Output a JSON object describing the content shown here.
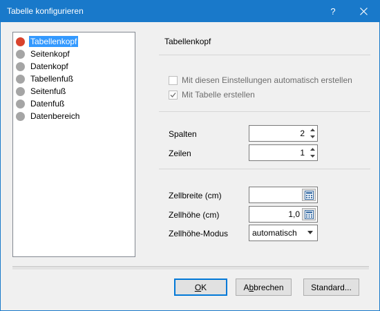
{
  "window": {
    "title": "Tabelle konfigurieren",
    "help_label": "?",
    "titlebar_color": "#1979ca"
  },
  "tree": {
    "items": [
      {
        "label": "Tabellenkopf",
        "selected": true,
        "icon": "red-circle-icon"
      },
      {
        "label": "Seitenkopf",
        "selected": false,
        "icon": "gray-circle-icon"
      },
      {
        "label": "Datenkopf",
        "selected": false,
        "icon": "gray-circle-icon"
      },
      {
        "label": "Tabellenfuß",
        "selected": false,
        "icon": "gray-circle-icon"
      },
      {
        "label": "Seitenfuß",
        "selected": false,
        "icon": "gray-circle-icon"
      },
      {
        "label": "Datenfuß",
        "selected": false,
        "icon": "gray-circle-icon"
      },
      {
        "label": "Datenbereich",
        "selected": false,
        "icon": "gray-circle-icon"
      }
    ],
    "selection_color": "#3399ff"
  },
  "panel": {
    "title": "Tabellenkopf",
    "auto_create_label": "Mit diesen Einstellungen automatisch erstellen",
    "auto_create_checked": false,
    "with_table_label": "Mit Tabelle erstellen",
    "with_table_checked": true,
    "columns_label": "Spalten",
    "columns_value": "2",
    "rows_label": "Zeilen",
    "rows_value": "1",
    "cell_width_label": "Zellbreite (cm)",
    "cell_width_value": "",
    "cell_height_label": "Zellhöhe (cm)",
    "cell_height_value": "1,0",
    "cell_height_mode_label": "Zellhöhe-Modus",
    "cell_height_mode_value": "automatisch"
  },
  "buttons": {
    "ok_pre": "",
    "ok_mnemonic": "O",
    "ok_post": "K",
    "cancel_pre": "A",
    "cancel_mnemonic": "b",
    "cancel_post": "brechen",
    "standard_label": "Standard..."
  }
}
